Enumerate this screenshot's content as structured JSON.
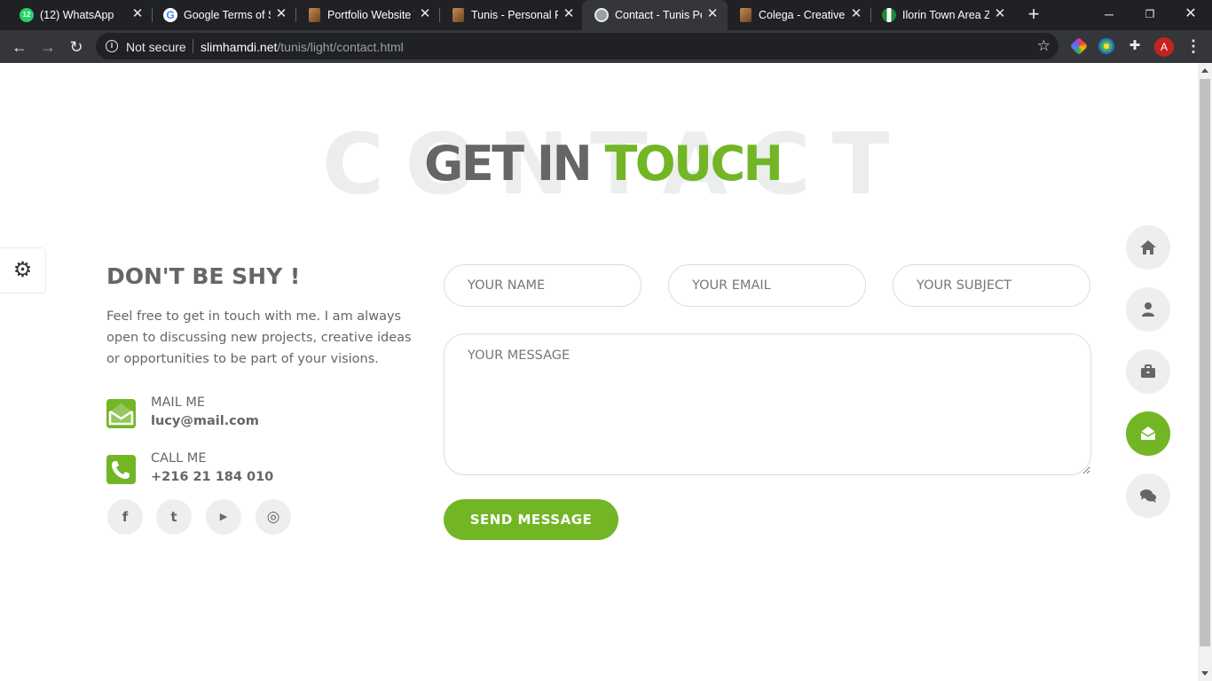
{
  "browser": {
    "tabs": [
      {
        "title": "(12) WhatsApp",
        "favicon": "whatsapp-icon",
        "badge": "12"
      },
      {
        "title": "Google Terms of Se",
        "favicon": "google-icon",
        "badge": "G"
      },
      {
        "title": "Portfolio Website T",
        "favicon": "book-icon"
      },
      {
        "title": "Tunis - Personal Po",
        "favicon": "book-icon"
      },
      {
        "title": "Contact - Tunis Pe",
        "favicon": "globe-icon",
        "active": true
      },
      {
        "title": "Colega - Creative P",
        "favicon": "book-icon"
      },
      {
        "title": "Ilorin Town Area Zi",
        "favicon": "nigeria-flag-icon"
      }
    ],
    "security_label": "Not secure",
    "url_host": "slimhamdi.net",
    "url_path": "/tunis/light/contact.html",
    "profile_initial": "A"
  },
  "page": {
    "background_word": "CONTACT",
    "heading_dark": "GET IN ",
    "heading_green": "TOUCH",
    "intro_title": "DON'T BE SHY !",
    "intro_text": "Feel free to get in touch with me. I am always open to discussing new projects, creative ideas or opportunities to be part of your visions.",
    "mail": {
      "label": "MAIL ME",
      "value": "lucy@mail.com"
    },
    "call": {
      "label": "CALL ME",
      "value": "+216 21 184 010"
    },
    "social": [
      {
        "name": "facebook-icon",
        "glyph": "f"
      },
      {
        "name": "twitter-icon",
        "glyph": "t"
      },
      {
        "name": "youtube-icon",
        "glyph": "▶"
      },
      {
        "name": "dribbble-icon",
        "glyph": "◎"
      }
    ],
    "form": {
      "name_placeholder": "YOUR NAME",
      "email_placeholder": "YOUR EMAIL",
      "subject_placeholder": "YOUR SUBJECT",
      "message_placeholder": "YOUR MESSAGE",
      "send_label": "SEND MESSAGE"
    },
    "side_nav": [
      "home-icon",
      "user-icon",
      "briefcase-icon",
      "envelope-open-icon",
      "comments-icon"
    ],
    "active_nav": "envelope-open-icon"
  },
  "colors": {
    "accent": "#72b626",
    "text": "#666666",
    "chrome_dark": "#202124",
    "chrome_toolbar": "#35363a"
  }
}
